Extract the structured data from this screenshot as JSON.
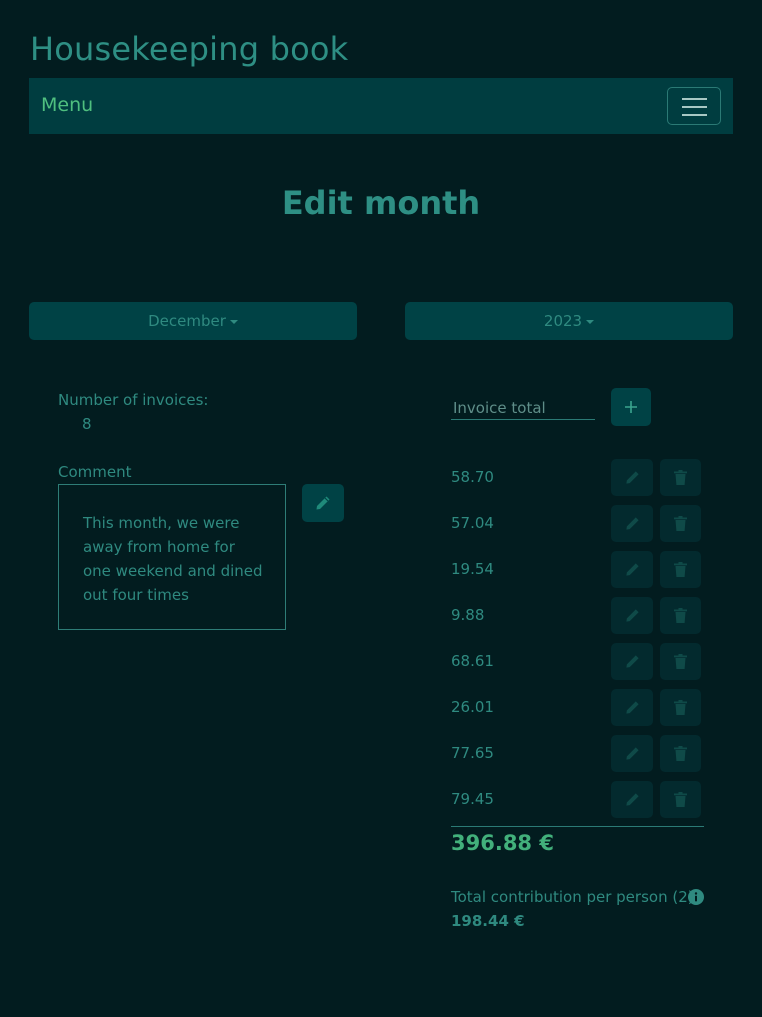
{
  "app": {
    "title": "Housekeeping book"
  },
  "navbar": {
    "menu_label": "Menu",
    "toggle_icon": "hamburger-icon"
  },
  "page": {
    "title": "Edit month"
  },
  "selectors": {
    "month": "December",
    "year": "2023"
  },
  "summary": {
    "invoice_count_label": "Number of invoices:",
    "invoice_count": "8",
    "comment_label": "Comment",
    "comment_text": "This month, we were away from home for one weekend and dined out four times"
  },
  "invoices": {
    "input_placeholder": "Invoice total",
    "add_icon": "plus-icon",
    "edit_icon": "pencil-icon",
    "delete_icon": "trash-icon",
    "values": [
      "58.70",
      "57.04",
      "19.54",
      "9.88",
      "68.61",
      "26.01",
      "77.65",
      "79.45"
    ],
    "total": "396.88 €",
    "contribution_label": "Total contribution per person (2)",
    "contribution_value": "198.44 €",
    "info_icon": "info-icon"
  },
  "colors": {
    "background": "#021c1f",
    "navbar": "#003d40",
    "accent": "#2e8f84",
    "menu_text": "#4fbf7f",
    "total_text": "#42b07b"
  }
}
